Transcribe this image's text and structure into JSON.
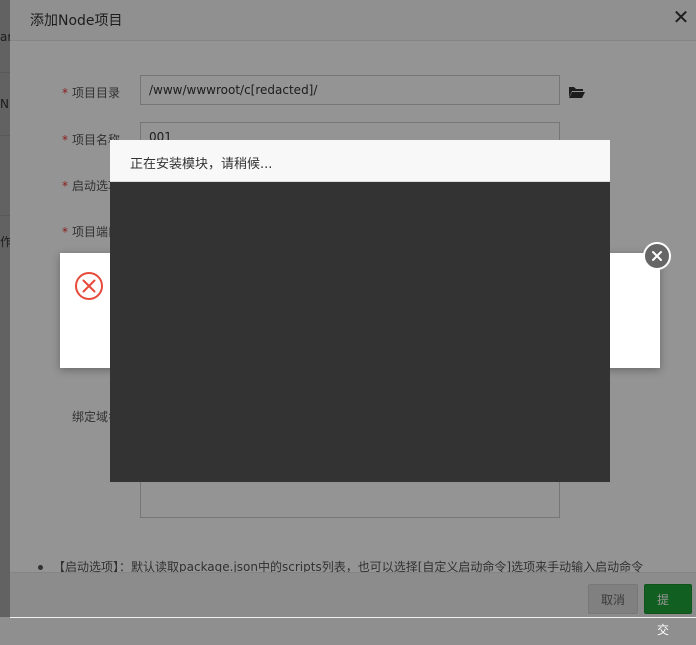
{
  "background_page": {
    "fragments": [
      "ar",
      "N",
      "作"
    ]
  },
  "dialog": {
    "title": "添加Node项目",
    "close_symbol": "✕",
    "fields": {
      "project_dir": {
        "label": "项目目录",
        "value": "/www/wwwroot/c[redacted]/"
      },
      "project_name": {
        "label": "项目名称",
        "value": "001"
      },
      "start_option": {
        "label": "启动选项"
      },
      "project_port": {
        "label": "项目端口"
      },
      "bind_domain": {
        "label": "绑定域名"
      }
    },
    "tip": "【启动选项】：默认读取package.json中的scripts列表，也可以选择[自定义启动命令]选项来手动输入启动命令",
    "buttons": {
      "cancel": "取消",
      "submit": "提交"
    }
  },
  "loading": {
    "message": "正在安装模块，请稍候..."
  },
  "error_toast": {
    "icon": "error-circle-icon",
    "close_icon": "close-circle-icon"
  },
  "colors": {
    "primary_green": "#20a53a",
    "required_red": "#e33333",
    "error_red": "#e64a3b",
    "loading_dark": "#333333"
  }
}
